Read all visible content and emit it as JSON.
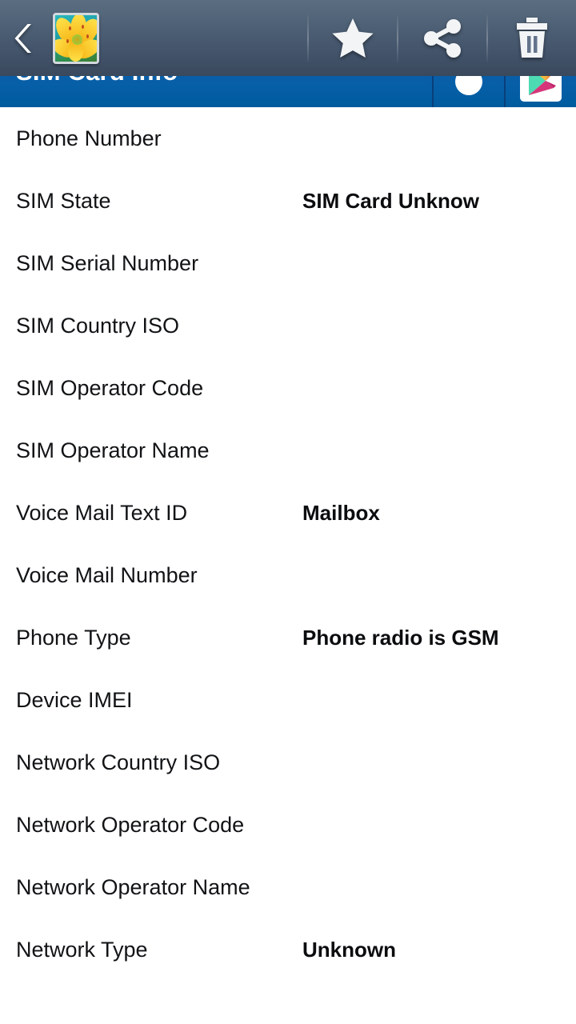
{
  "overlay_toolbar": {
    "back_label": "‹",
    "back_icon": "chevron-left-icon",
    "thumbnail_icon": "photo-thumbnail-lily",
    "actions": [
      {
        "icon": "star-icon",
        "label": "Favorite"
      },
      {
        "icon": "share-icon",
        "label": "Share"
      },
      {
        "icon": "trash-icon",
        "label": "Delete"
      }
    ]
  },
  "app_header": {
    "title": "SIM Card Info",
    "background_color": "#0a5ea9",
    "actions": [
      {
        "icon": "refresh-circle-icon",
        "label": "Refresh"
      },
      {
        "icon": "play-store-icon",
        "label": "Play Store"
      }
    ]
  },
  "info_list": [
    {
      "label": "Phone Number",
      "value": ""
    },
    {
      "label": "SIM State",
      "value": "SIM Card Unknow"
    },
    {
      "label": "SIM Serial Number",
      "value": ""
    },
    {
      "label": "SIM Country ISO",
      "value": ""
    },
    {
      "label": "SIM Operator Code",
      "value": ""
    },
    {
      "label": "SIM Operator Name",
      "value": ""
    },
    {
      "label": "Voice Mail Text ID",
      "value": "Mailbox"
    },
    {
      "label": "Voice Mail Number",
      "value": ""
    },
    {
      "label": "Phone Type",
      "value": "Phone radio is GSM"
    },
    {
      "label": "Device IMEI",
      "value": ""
    },
    {
      "label": "Network Country ISO",
      "value": ""
    },
    {
      "label": "Network Operator Code",
      "value": ""
    },
    {
      "label": "Network Operator Name",
      "value": ""
    },
    {
      "label": "Network Type",
      "value": "Unknown"
    }
  ],
  "colors": {
    "header_blue": "#0a5ea9",
    "toolbar_slate_top": "#5b6e81",
    "toolbar_slate_bottom": "#3a495c",
    "text_primary": "#111315",
    "page_background": "#ffffff"
  }
}
